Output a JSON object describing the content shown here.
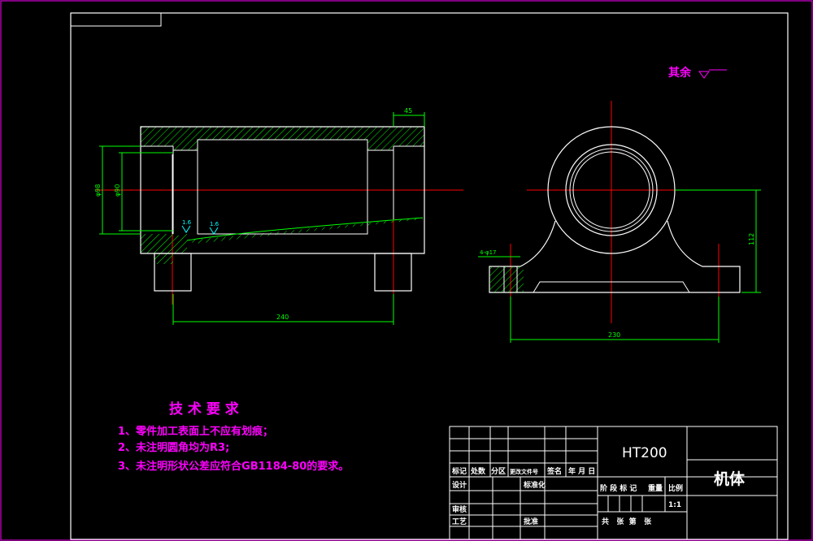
{
  "surface_note": "其余",
  "dimensions": {
    "length_240": "240",
    "width_230": "230",
    "height_112": "112",
    "top_45": "45",
    "dia_98": "φ98",
    "dia_90": "φ90",
    "holes": "4-φ17",
    "roughness_a": "1.6",
    "roughness_b": "1.6"
  },
  "tech_requirements": {
    "title": "技 术 要 求",
    "items": [
      "1、零件加工表面上不应有划痕；",
      "2、未注明圆角均为R3;",
      "3、未注明形状公差应符合GB1184-80的要求。"
    ]
  },
  "title_block": {
    "material": "HT200",
    "part_name": "机体",
    "header_row": [
      "标记",
      "处数",
      "分区",
      "更改文件号",
      "签名",
      "年 月 日"
    ],
    "left_labels": [
      "设计",
      "审核",
      "工艺"
    ],
    "mid_labels": [
      "标准化",
      "批准"
    ],
    "stage_labels": [
      "阶 段 标 记",
      "重量",
      "比例"
    ],
    "scale": "1:1",
    "sheet_info": "共   张  第   张"
  },
  "colors": {
    "outline": "#ffffff",
    "dimension": "#00ff00",
    "centerline": "#ff0000",
    "annotation": "#ff00ff",
    "border": "#ff00ff"
  }
}
